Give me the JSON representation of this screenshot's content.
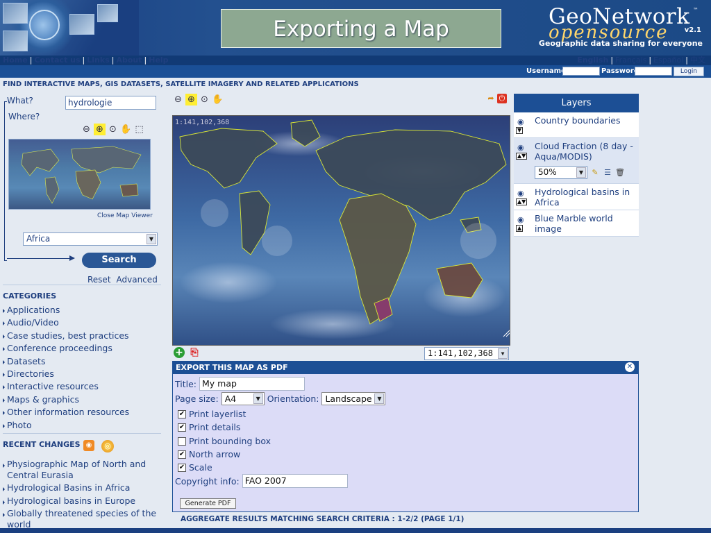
{
  "slide_title": "Exporting a Map",
  "logo": {
    "name_top": "GeoNetwork",
    "name_bottom": "opensource",
    "version": "v2.1",
    "trademark": "™",
    "tagline": "Geographic data sharing for everyone"
  },
  "nav": {
    "links": [
      "Home",
      "Contact us",
      "Links",
      "About",
      "Help"
    ],
    "languages": [
      "English",
      "Français",
      "Español",
      "中文"
    ]
  },
  "login": {
    "username_label": "Username",
    "password_label": "Password",
    "button": "Login"
  },
  "find_title": "FIND INTERACTIVE MAPS, GIS DATASETS, SATELLITE IMAGERY AND RELATED APPLICATIONS",
  "search": {
    "what_label": "What?",
    "what_value": "hydrologie",
    "where_label": "Where?",
    "close_viewer": "Close Map Viewer",
    "region": "Africa",
    "search_button": "Search",
    "reset": "Reset",
    "advanced": "Advanced"
  },
  "categories": {
    "title": "CATEGORIES",
    "items": [
      "Applications",
      "Audio/Video",
      "Case studies, best practices",
      "Conference proceedings",
      "Datasets",
      "Directories",
      "Interactive resources",
      "Maps & graphics",
      "Other information resources",
      "Photo"
    ]
  },
  "recent": {
    "title": "RECENT CHANGES",
    "items": [
      "Physiographic Map of North and Central Eurasia",
      "Hydrological Basins in Africa",
      "Hydrological basins in Europe",
      "Globally threatened species of the world"
    ]
  },
  "map": {
    "scale_text": "1:141,102,368",
    "scale_select": "1:141,102,368"
  },
  "layers": {
    "title": "Layers",
    "items": [
      "Country boundaries",
      "Cloud Fraction (8 day - Aqua/MODIS)",
      "Hydrological basins in Africa",
      "Blue Marble world image"
    ],
    "opacity": "50%"
  },
  "export": {
    "title": "EXPORT THIS MAP AS PDF",
    "title_label": "Title:",
    "title_value": "My map",
    "page_size_label": "Page size:",
    "page_size_value": "A4",
    "orientation_label": "Orientation:",
    "orientation_value": "Landscape",
    "options": [
      {
        "label": "Print layerlist",
        "checked": true
      },
      {
        "label": "Print details",
        "checked": true
      },
      {
        "label": "Print bounding box",
        "checked": false
      },
      {
        "label": "North arrow",
        "checked": true
      },
      {
        "label": "Scale",
        "checked": true
      }
    ],
    "copyright_label": "Copyright info:",
    "copyright_value": "FAO 2007",
    "generate_button": "Generate PDF"
  },
  "aggregate": "AGGREGATE RESULTS MATCHING SEARCH CRITERIA :  1-2/2  (PAGE 1/1)",
  "colors": {
    "header": "#1a3f80",
    "nav": "#113a75",
    "accent": "#1c4f95",
    "export_bg": "#dcdcf7",
    "title_box": "#8da891"
  }
}
